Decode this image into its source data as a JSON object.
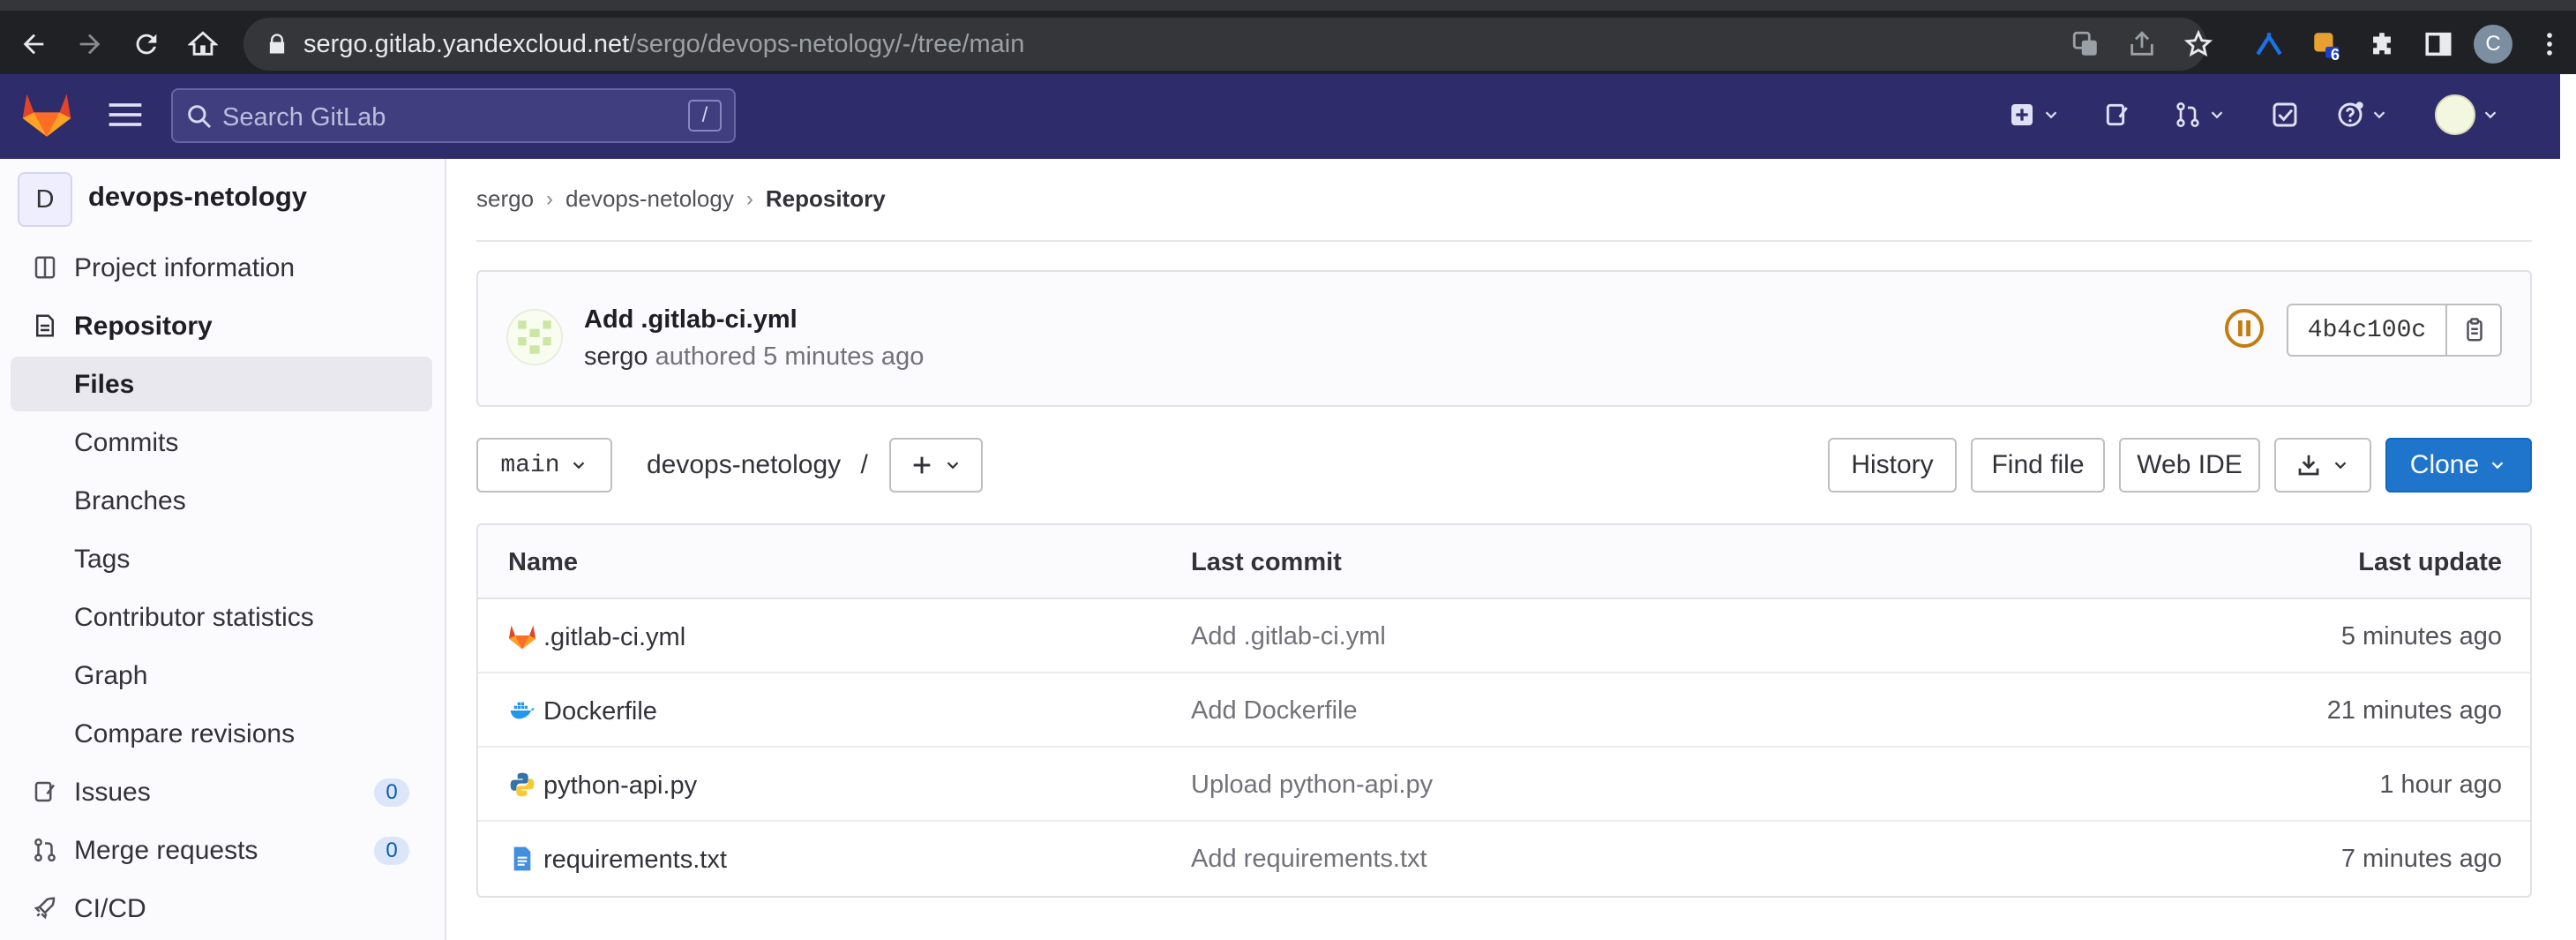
{
  "browser": {
    "url_host": "sergo.gitlab.yandexcloud.net",
    "url_path": "/sergo/devops-netology/-/tree/main",
    "extension_badge": "6",
    "profile_initial": "C"
  },
  "header": {
    "search_placeholder": "Search GitLab",
    "search_shortcut": "/"
  },
  "sidebar": {
    "project_initial": "D",
    "project_name": "devops-netology",
    "items": [
      {
        "label": "Project information",
        "icon": "information-icon"
      },
      {
        "label": "Repository",
        "icon": "repository-icon"
      },
      {
        "label": "Files",
        "active": true
      },
      {
        "label": "Commits"
      },
      {
        "label": "Branches"
      },
      {
        "label": "Tags"
      },
      {
        "label": "Contributor statistics"
      },
      {
        "label": "Graph"
      },
      {
        "label": "Compare revisions"
      },
      {
        "label": "Issues",
        "icon": "issues-icon",
        "badge": "0"
      },
      {
        "label": "Merge requests",
        "icon": "merge-request-icon",
        "badge": "0"
      },
      {
        "label": "CI/CD",
        "icon": "rocket-icon"
      }
    ]
  },
  "breadcrumb": [
    "sergo",
    "devops-netology",
    "Repository"
  ],
  "commit": {
    "title": "Add .gitlab-ci.yml",
    "author": "sergo",
    "meta": "authored 5 minutes ago",
    "sha": "4b4c100c",
    "pipeline_status": "paused"
  },
  "toolbar": {
    "branch": "main",
    "path": "devops-netology",
    "path_sep": "/",
    "history": "History",
    "find_file": "Find file",
    "web_ide": "Web IDE",
    "clone": "Clone"
  },
  "table": {
    "headers": [
      "Name",
      "Last commit",
      "Last update"
    ],
    "rows": [
      {
        "name": ".gitlab-ci.yml",
        "icon": "gitlab-icon",
        "commit": "Add .gitlab-ci.yml",
        "updated": "5 minutes ago"
      },
      {
        "name": "Dockerfile",
        "icon": "docker-icon",
        "commit": "Add Dockerfile",
        "updated": "21 minutes ago"
      },
      {
        "name": "python-api.py",
        "icon": "python-icon",
        "commit": "Upload python-api.py",
        "updated": "1 hour ago"
      },
      {
        "name": "requirements.txt",
        "icon": "text-file-icon",
        "commit": "Add requirements.txt",
        "updated": "7 minutes ago"
      }
    ]
  },
  "colors": {
    "header_bg": "#2e2c6a",
    "accent": "#1f75cb",
    "pipeline_status": "#c17d10"
  }
}
